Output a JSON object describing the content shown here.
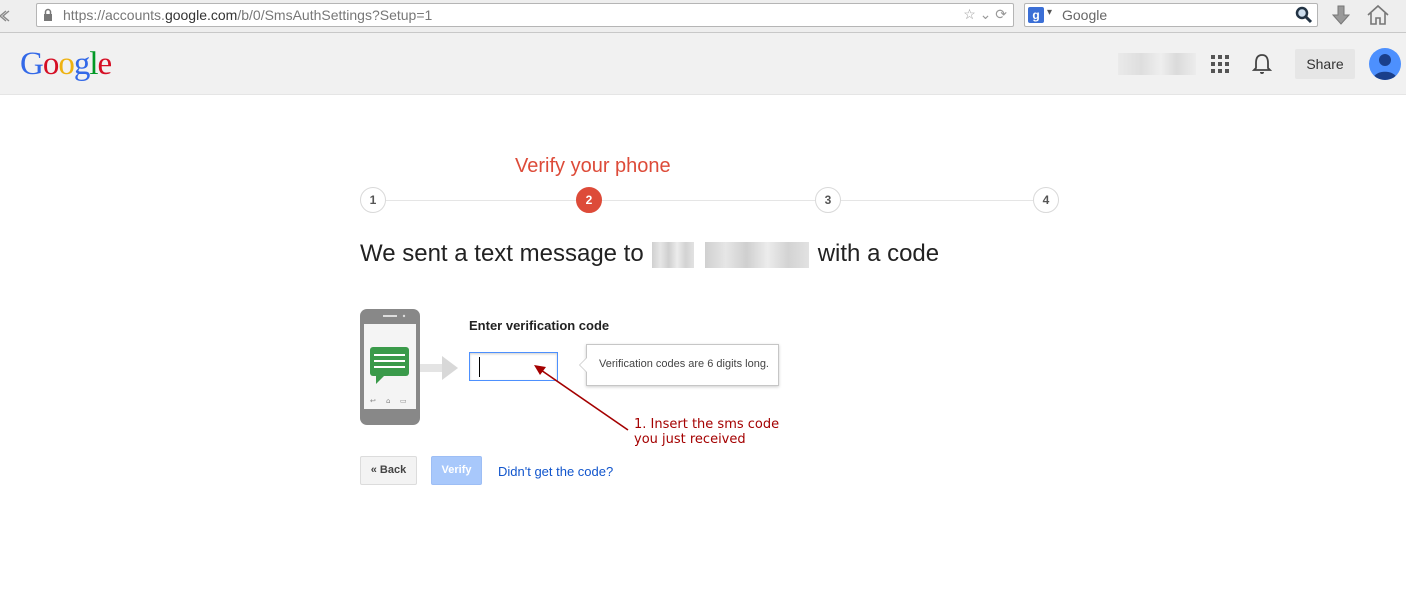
{
  "browser": {
    "url_prefix": "https://accounts.",
    "url_domain": "google.com",
    "url_path": "/b/0/SmsAuthSettings?Setup=1",
    "search_placeholder": "Google",
    "search_engine_letter": "g"
  },
  "header": {
    "logo_letters": [
      "G",
      "o",
      "o",
      "g",
      "l",
      "e"
    ],
    "share_label": "Share"
  },
  "steps": {
    "title": "Verify your phone",
    "items": [
      {
        "label": "1",
        "active": false
      },
      {
        "label": "2",
        "active": true
      },
      {
        "label": "3",
        "active": false
      },
      {
        "label": "4",
        "active": false
      }
    ]
  },
  "main": {
    "heading_before": "We sent a text message to",
    "heading_after": "with a code",
    "code_label": "Enter verification code",
    "code_value": "",
    "tooltip": "Verification codes are 6 digits long."
  },
  "annotation": {
    "text": "1. Insert the sms code\nyou just received",
    "color": "#a40000"
  },
  "actions": {
    "back_label": "« Back",
    "verify_label": "Verify",
    "resend_label": "Didn't get the code?"
  },
  "colors": {
    "accent_red": "#dd4b39",
    "link_blue": "#1155cc",
    "focus_blue": "#4d90fe",
    "verify_disabled": "#a8c8fb"
  }
}
